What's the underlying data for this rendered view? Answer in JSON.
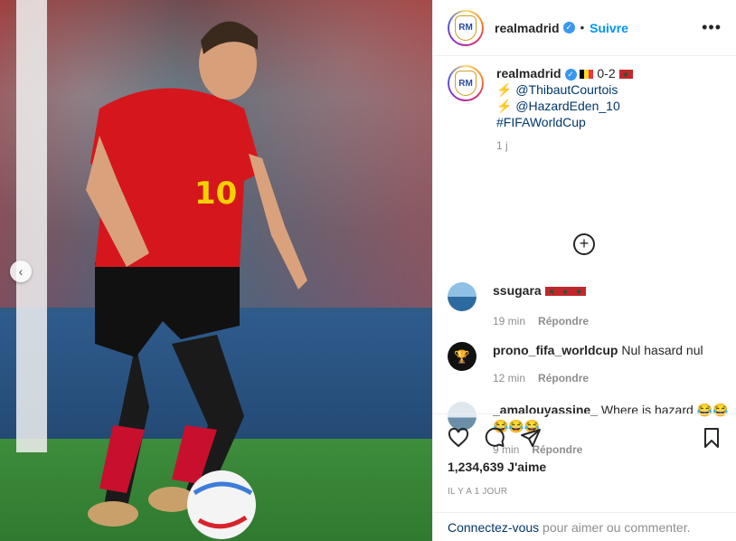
{
  "media": {
    "carousel_prev": "‹"
  },
  "header": {
    "username": "realmadrid",
    "verified": "✓",
    "dot": "•",
    "follow": "Suivre",
    "more": "•••"
  },
  "caption": {
    "username": "realmadrid",
    "verified": "✓",
    "score": "0-2",
    "lines": [
      {
        "icon": "⚡",
        "mention": "@ThibautCourtois"
      },
      {
        "icon": "⚡",
        "mention": "@HazardEden_10"
      }
    ],
    "hashtag": "#FIFAWorldCup",
    "time": "1 j"
  },
  "load_more": "+",
  "comments": [
    {
      "username": "ssugara",
      "text": "",
      "time": "19 min",
      "reply": "Répondre"
    },
    {
      "username": "prono_fifa_worldcup",
      "text": "Nul hasard nul",
      "time": "12 min",
      "reply": "Répondre"
    },
    {
      "username": "_amalouyassine_",
      "text": "Where is hazard 😂😂",
      "text2": "😂😂😂",
      "time": "9 min",
      "reply": "Répondre"
    }
  ],
  "likes": "1,234,639 J'aime",
  "date": "IL Y A 1 JOUR",
  "footer": {
    "link": "Connectez-vous",
    "rest": " pour aimer ou commenter."
  },
  "colors": {
    "accent": "#0095f6",
    "verified": "#3897f0",
    "link": "#00376b",
    "muted": "#8e8e8e"
  }
}
